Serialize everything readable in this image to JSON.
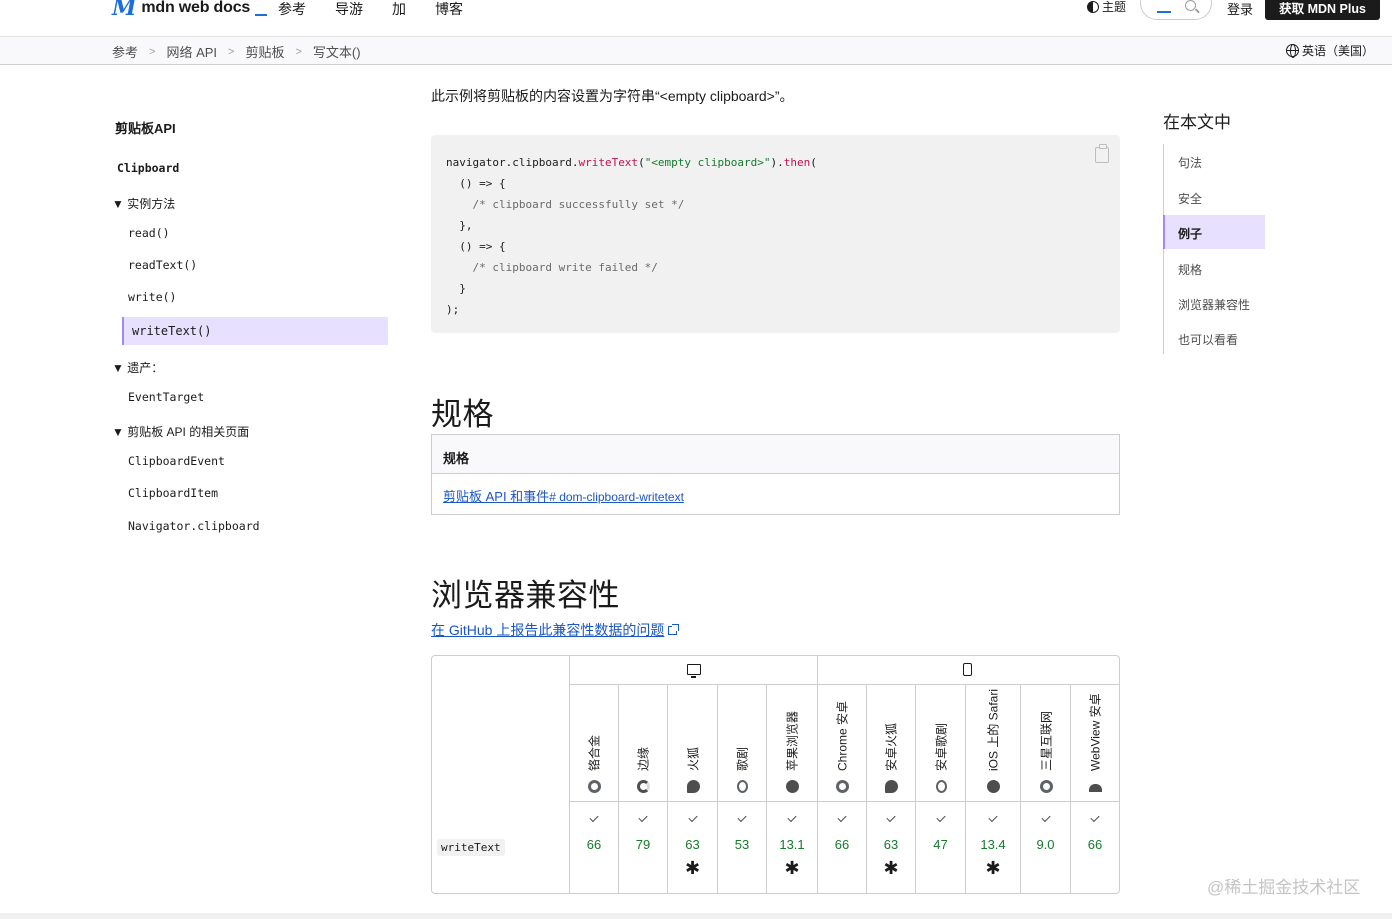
{
  "header": {
    "logo_mark": "M",
    "logo_text": "mdn web docs",
    "nav": [
      "参考",
      "导游",
      "加",
      "博客"
    ],
    "theme_label": "主题",
    "login_label": "登录",
    "plus_label": "获取 MDN Plus"
  },
  "breadcrumb": {
    "items": [
      "参考",
      "网络 API",
      "剪贴板",
      "写文本()"
    ],
    "language": "英语（美国）"
  },
  "sidebar": {
    "title": "剪贴板API",
    "interface": "Clipboard",
    "group_methods": "▼ 实例方法",
    "methods": [
      "read()",
      "readText()",
      "write()",
      "writeText()"
    ],
    "group_inherit": "▼ 遗产：",
    "inherit": [
      "EventTarget"
    ],
    "group_related": "▼ 剪贴板 API 的相关页面",
    "related": [
      "ClipboardEvent",
      "ClipboardItem",
      "Navigator.clipboard"
    ]
  },
  "main": {
    "intro": "此示例将剪贴板的内容设置为字符串“<empty clipboard>”。",
    "code": {
      "l1a": "navigator.clipboard.",
      "l1b": "writeText",
      "l1c": "(",
      "l1d": "\"<empty clipboard>\"",
      "l1e": ").",
      "l1f": "then",
      "l1g": "(",
      "l2": "  () => {",
      "l3": "    /* clipboard successfully set */",
      "l4": "  },",
      "l5": "  () => {",
      "l6": "    /* clipboard write failed */",
      "l7": "  }",
      "l8": ");"
    },
    "spec_heading": "规格",
    "spec_table_header": "规格",
    "spec_link_text": "剪贴板 API 和事件",
    "spec_link_anchor": "# dom-clipboard-writetext",
    "compat_heading": "浏览器兼容性",
    "github_link": "在 GitHub 上报告此兼容性数据的问题",
    "compat": {
      "feature": "writeText",
      "browsers": [
        {
          "name": "铬合金",
          "version": "66",
          "star": ""
        },
        {
          "name": "边缘",
          "version": "79",
          "star": ""
        },
        {
          "name": "火狐",
          "version": "63",
          "star": "✱"
        },
        {
          "name": "歌剧",
          "version": "53",
          "star": ""
        },
        {
          "name": "苹果浏览器",
          "version": "13.1",
          "star": "✱"
        },
        {
          "name": "Chrome 安卓",
          "version": "66",
          "star": ""
        },
        {
          "name": "安卓火狐",
          "version": "63",
          "star": "✱"
        },
        {
          "name": "安卓歌剧",
          "version": "47",
          "star": ""
        },
        {
          "name": "iOS 上的 Safari",
          "version": "13.4",
          "star": "✱"
        },
        {
          "name": "三星互联网",
          "version": "9.0",
          "star": ""
        },
        {
          "name": "WebView 安卓",
          "version": "66",
          "star": ""
        }
      ]
    }
  },
  "toc": {
    "title": "在本文中",
    "items": [
      "句法",
      "安全",
      "例子",
      "规格",
      "浏览器兼容性",
      "也可以看看"
    ]
  },
  "watermark": "@稀土掘金技术社区"
}
